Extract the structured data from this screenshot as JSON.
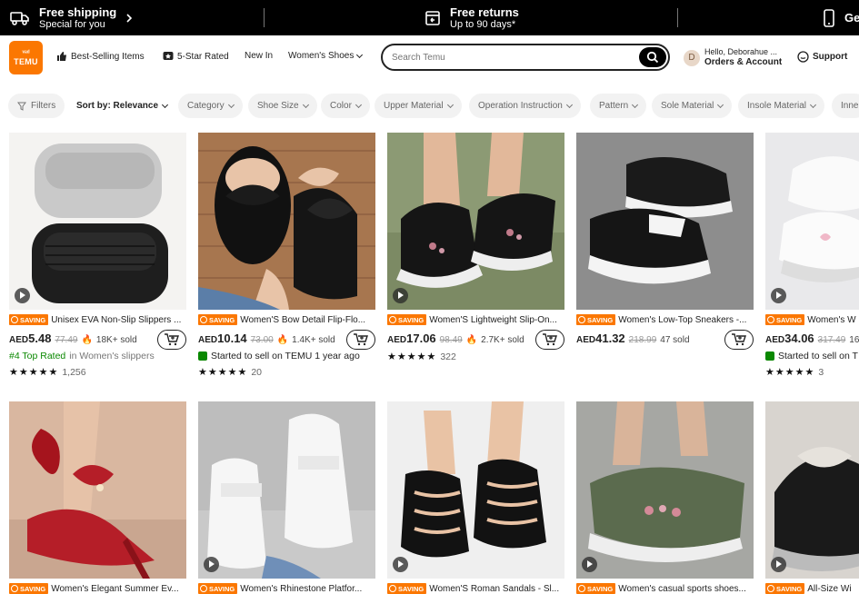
{
  "promo": {
    "shipping_title": "Free shipping",
    "shipping_sub": "Special for you",
    "returns_title": "Free returns",
    "returns_sub": "Up to 90 days*",
    "app_title": "Ge"
  },
  "header": {
    "logo_top": "ᵛᵃᵈ",
    "logo_text": "TEMU",
    "nav": [
      "Best-Selling Items",
      "5-Star Rated",
      "New In",
      "Women's Shoes"
    ],
    "search_placeholder": "Search Temu",
    "account_greeting": "Hello, Deborahue ...",
    "account_label": "Orders & Account",
    "avatar_letter": "D",
    "support": "Support"
  },
  "filters": [
    "Filters",
    "Sort by: Relevance",
    "Category",
    "Shoe Size",
    "Color",
    "Upper Material",
    "Operation Instruction",
    "Pattern",
    "Sole Material",
    "Insole Material",
    "Inne"
  ],
  "saving_label": "SAVING",
  "products": [
    {
      "title": "Unisex EVA Non-Slip Slippers ...",
      "currency": "AED",
      "price": "5.48",
      "old": "77.49",
      "flame": true,
      "sold": "18K+ sold",
      "meta_type": "rank",
      "meta_rank": "#4 Top Rated",
      "meta_rest": "in Women's slippers",
      "stars": "★★★★★",
      "reviews": "1,256",
      "video": true
    },
    {
      "title": "Women'S Bow Detail Flip-Flo...",
      "currency": "AED",
      "price": "10.14",
      "old": "73.00",
      "flame": true,
      "sold": "1.4K+ sold",
      "meta_type": "new",
      "meta_rest": "Started to sell on TEMU 1 year ago",
      "stars": "★★★★★",
      "reviews": "20",
      "video": false
    },
    {
      "title": "Women'S Lightweight Slip-On...",
      "currency": "AED",
      "price": "17.06",
      "old": "98.49",
      "flame": true,
      "sold": "2.7K+ sold",
      "meta_type": "none",
      "stars": "★★★★★",
      "reviews": "322",
      "video": true
    },
    {
      "title": "Women's Low-Top Sneakers -...",
      "currency": "AED",
      "price": "41.32",
      "old": "218.99",
      "flame": false,
      "sold": "47 sold",
      "meta_type": "none",
      "stars": "",
      "reviews": "",
      "video": false
    },
    {
      "title": "Women's W",
      "currency": "AED",
      "price": "34.06",
      "old": "317.49",
      "flame": false,
      "sold": "16",
      "meta_type": "new",
      "meta_rest": "Started to sell on T",
      "stars": "★★★★★",
      "reviews": "3",
      "video": true
    },
    {
      "title": "Women's Elegant Summer Ev...",
      "video": false
    },
    {
      "title": "Women's Rhinestone Platfor...",
      "video": true
    },
    {
      "title": "Women'S Roman Sandals - Sl...",
      "video": true
    },
    {
      "title": "Women's casual sports shoes...",
      "video": true
    },
    {
      "title": "All-Size Wi",
      "video": true
    }
  ],
  "colors": {
    "accent": "#fb7701",
    "green": "#0a8800",
    "black": "#000000"
  }
}
